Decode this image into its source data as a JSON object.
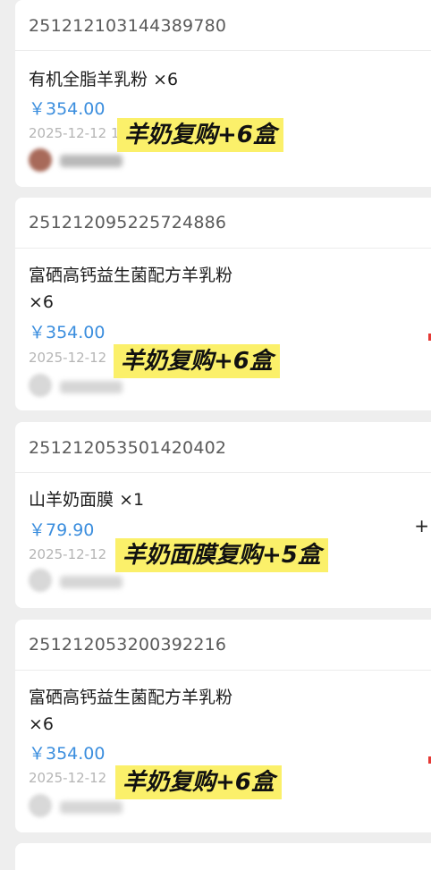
{
  "orders": [
    {
      "order_no": "251212103144389780",
      "product": "有机全脂羊乳粉",
      "qty": "×6",
      "price": "￥354.00",
      "date": "2025-12-12 1",
      "badge": "羊奶复购+6盒"
    },
    {
      "order_no": "251212095225724886",
      "product": "富硒高钙益生菌配方羊乳粉",
      "qty": "×6",
      "price": "￥354.00",
      "date": "2025-12-12",
      "badge": "羊奶复购+6盒"
    },
    {
      "order_no": "251212053501420402",
      "product": "山羊奶面膜",
      "qty": "×1",
      "price": "￥79.90",
      "date": "2025-12-12",
      "badge": "羊奶面膜复购+5盒",
      "right_mark": "+"
    },
    {
      "order_no": "251212053200392216",
      "product": "富硒高钙益生菌配方羊乳粉",
      "qty": "×6",
      "price": "￥354.00",
      "date": "2025-12-12",
      "badge": "羊奶复购+6盒"
    }
  ],
  "colors": {
    "price": "#3b8ede",
    "badge_bg": "#fbf06a",
    "accent_red": "#e53935"
  }
}
